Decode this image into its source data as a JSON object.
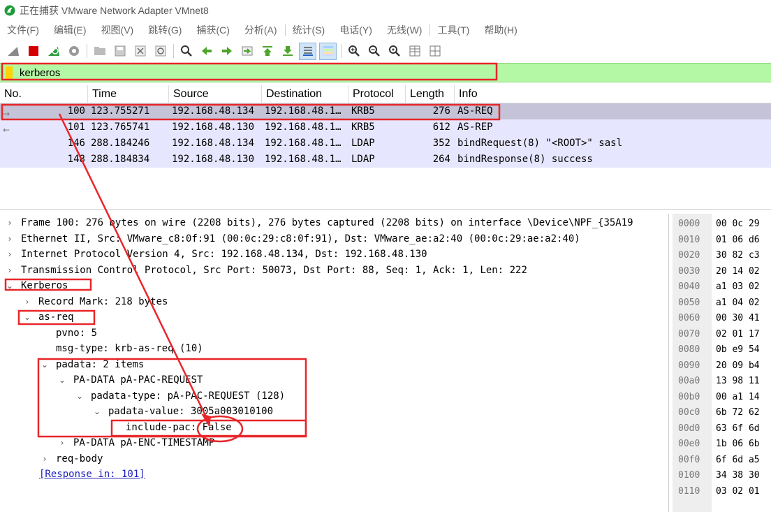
{
  "window": {
    "title": "正在捕获 VMware Network Adapter VMnet8"
  },
  "menu": [
    "文件(F)",
    "编辑(E)",
    "视图(V)",
    "跳转(G)",
    "捕获(C)",
    "分析(A)",
    "统计(S)",
    "电话(Y)",
    "无线(W)",
    "工具(T)",
    "帮助(H)"
  ],
  "toolbar_icons": [
    "shark-fin-icon",
    "stop-icon",
    "restart-icon",
    "gear-icon",
    "open-icon",
    "save-icon",
    "close-file-icon",
    "reload-icon",
    "find-icon",
    "back-icon",
    "forward-icon",
    "goto-icon",
    "first-icon",
    "last-icon",
    "autoscroll-icon",
    "colorize-icon",
    "zoom-in-icon",
    "zoom-out-icon",
    "zoom-reset-icon",
    "resize-columns-icon",
    "layout-icon"
  ],
  "filter": {
    "value": "kerberos"
  },
  "packet_list": {
    "columns": [
      "No.",
      "Time",
      "Source",
      "Destination",
      "Protocol",
      "Length",
      "Info"
    ],
    "rows": [
      {
        "no": "100",
        "time": "123.755271",
        "src": "192.168.48.134",
        "dst": "192.168.48.1…",
        "proto": "KRB5",
        "len": "276",
        "info": "AS-REQ"
      },
      {
        "no": "101",
        "time": "123.765741",
        "src": "192.168.48.130",
        "dst": "192.168.48.1…",
        "proto": "KRB5",
        "len": "612",
        "info": "AS-REP"
      },
      {
        "no": "146",
        "time": "288.184246",
        "src": "192.168.48.134",
        "dst": "192.168.48.1…",
        "proto": "LDAP",
        "len": "352",
        "info": "bindRequest(8) \"<ROOT>\" sasl"
      },
      {
        "no": "148",
        "time": "288.184834",
        "src": "192.168.48.130",
        "dst": "192.168.48.1…",
        "proto": "LDAP",
        "len": "264",
        "info": "bindResponse(8) success"
      }
    ]
  },
  "details": {
    "frame": "Frame 100: 276 bytes on wire (2208 bits), 276 bytes captured (2208 bits) on interface \\Device\\NPF_{35A19",
    "ethernet": "Ethernet II, Src: VMware_c8:0f:91 (00:0c:29:c8:0f:91), Dst: VMware_ae:a2:40 (00:0c:29:ae:a2:40)",
    "ip": "Internet Protocol Version 4, Src: 192.168.48.134, Dst: 192.168.48.130",
    "tcp": "Transmission Control Protocol, Src Port: 50073, Dst Port: 88, Seq: 1, Ack: 1, Len: 222",
    "kerberos": "Kerberos",
    "record_mark": "Record Mark: 218 bytes",
    "as_req": "as-req",
    "pvno": "pvno: 5",
    "msg_type": "msg-type: krb-as-req (10)",
    "padata": "padata: 2 items",
    "pa_data_pac": "PA-DATA pA-PAC-REQUEST",
    "padata_type": "padata-type: pA-PAC-REQUEST (128)",
    "padata_value": "padata-value: 3005a003010100",
    "include_pac_label": "include-pac:",
    "include_pac_value": "False",
    "pa_data_enc": "PA-DATA pA-ENC-TIMESTAMP",
    "req_body": "req-body",
    "response_link": "[Response in: 101]"
  },
  "hex": [
    {
      "off": "0000",
      "bytes": "00 0c 29"
    },
    {
      "off": "0010",
      "bytes": "01 06 d6"
    },
    {
      "off": "0020",
      "bytes": "30 82 c3"
    },
    {
      "off": "0030",
      "bytes": "20 14 02"
    },
    {
      "off": "0040",
      "bytes": "a1 03 02"
    },
    {
      "off": "0050",
      "bytes": "a1 04 02"
    },
    {
      "off": "0060",
      "bytes": "00 30 41"
    },
    {
      "off": "0070",
      "bytes": "02 01 17"
    },
    {
      "off": "0080",
      "bytes": "0b e9 54"
    },
    {
      "off": "0090",
      "bytes": "20 09 b4"
    },
    {
      "off": "00a0",
      "bytes": "13 98 11"
    },
    {
      "off": "00b0",
      "bytes": "00 a1 14"
    },
    {
      "off": "00c0",
      "bytes": "6b 72 62"
    },
    {
      "off": "00d0",
      "bytes": "63 6f 6d"
    },
    {
      "off": "00e0",
      "bytes": "1b 06 6b"
    },
    {
      "off": "00f0",
      "bytes": "6f 6d a5"
    },
    {
      "off": "0100",
      "bytes": "34 38 30"
    },
    {
      "off": "0110",
      "bytes": "03 02 01"
    }
  ],
  "colors": {
    "filter_ok": "#b4f7a4",
    "row_bg": "#e7e6ff",
    "row_selected": "#c4c3d8",
    "annotation": "#e8262a"
  }
}
